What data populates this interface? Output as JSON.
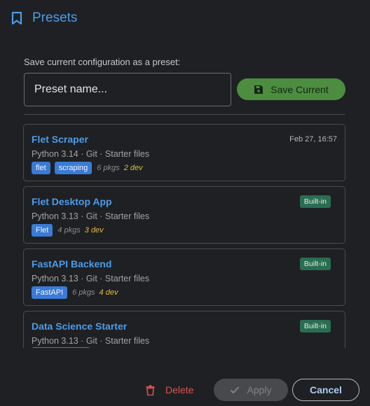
{
  "header": {
    "title": "Presets",
    "icon": "bookmark-icon"
  },
  "save": {
    "label": "Save current configuration as a preset:",
    "input_placeholder": "Preset name...",
    "input_value": "",
    "button_label": "Save Current",
    "button_icon": "floppy-disk-icon"
  },
  "presets": [
    {
      "name": "Flet Scraper",
      "meta": "Python 3.14 · Git · Starter files",
      "date": "Feb 27, 16:57",
      "builtin": "",
      "tags": [
        "flet",
        "scraping"
      ],
      "pkgs": "6 pkgs",
      "dev": "2 dev"
    },
    {
      "name": "Flet Desktop App",
      "meta": "Python 3.13 · Git · Starter files",
      "date": "",
      "builtin": "Built-in",
      "tags": [
        "Flet"
      ],
      "pkgs": "4 pkgs",
      "dev": "3 dev"
    },
    {
      "name": "FastAPI Backend",
      "meta": "Python 3.13 · Git · Starter files",
      "date": "",
      "builtin": "Built-in",
      "tags": [
        "FastAPI"
      ],
      "pkgs": "6 pkgs",
      "dev": "4 dev"
    },
    {
      "name": "Data Science Starter",
      "meta": "Python 3.13 · Git · Starter files",
      "date": "",
      "builtin": "Built-in",
      "tags": [],
      "pkgs": "",
      "dev": ""
    }
  ],
  "footer": {
    "delete_label": "Delete",
    "apply_label": "Apply",
    "cancel_label": "Cancel"
  },
  "colors": {
    "accent": "#4c9ce8",
    "save_button": "#4c8d3f",
    "builtin_badge": "#2a6e52",
    "tag": "#3a7bd5",
    "delete": "#d9534f",
    "dev_count": "#e0bc3f",
    "background": "#1f2023"
  }
}
